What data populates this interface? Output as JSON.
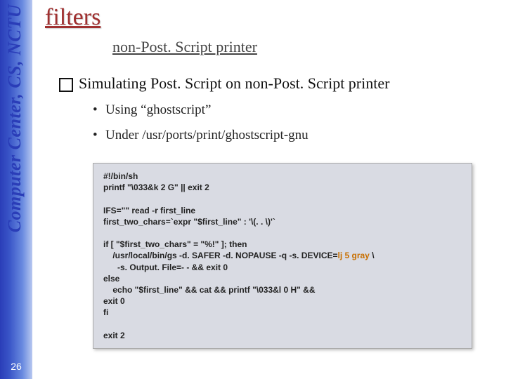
{
  "sidebar": {
    "org": "Computer Center, CS, NCTU",
    "page_number": "26"
  },
  "slide": {
    "title": "filters",
    "subtitle": "non-Post. Script printer",
    "bullet_main": "Simulating Post. Script on non-Post. Script printer",
    "sub1": "Using “ghostscript”",
    "sub2": "Under /usr/ports/print/ghostscript-gnu"
  },
  "code": {
    "l1": "#!/bin/sh",
    "l2": "printf \"\\033&k 2 G\" || exit 2",
    "l3": "IFS=\"\" read -r first_line",
    "l4": "first_two_chars=`expr \"$first_line\" : '\\(. . \\)'`",
    "l5": "if [ \"$first_two_chars\" = \"%!\" ]; then",
    "l6a": "    /usr/local/bin/gs -d. SAFER -d. NOPAUSE -q -s. DEVICE=",
    "l6b": "lj 5 gray",
    "l6c": " \\",
    "l7": "      -s. Output. File=- - && exit 0",
    "l8": "else",
    "l9": "    echo \"$first_line\" && cat && printf \"\\033&l 0 H\" &&",
    "l10": "exit 0",
    "l11": "fi",
    "l12": "exit 2"
  }
}
